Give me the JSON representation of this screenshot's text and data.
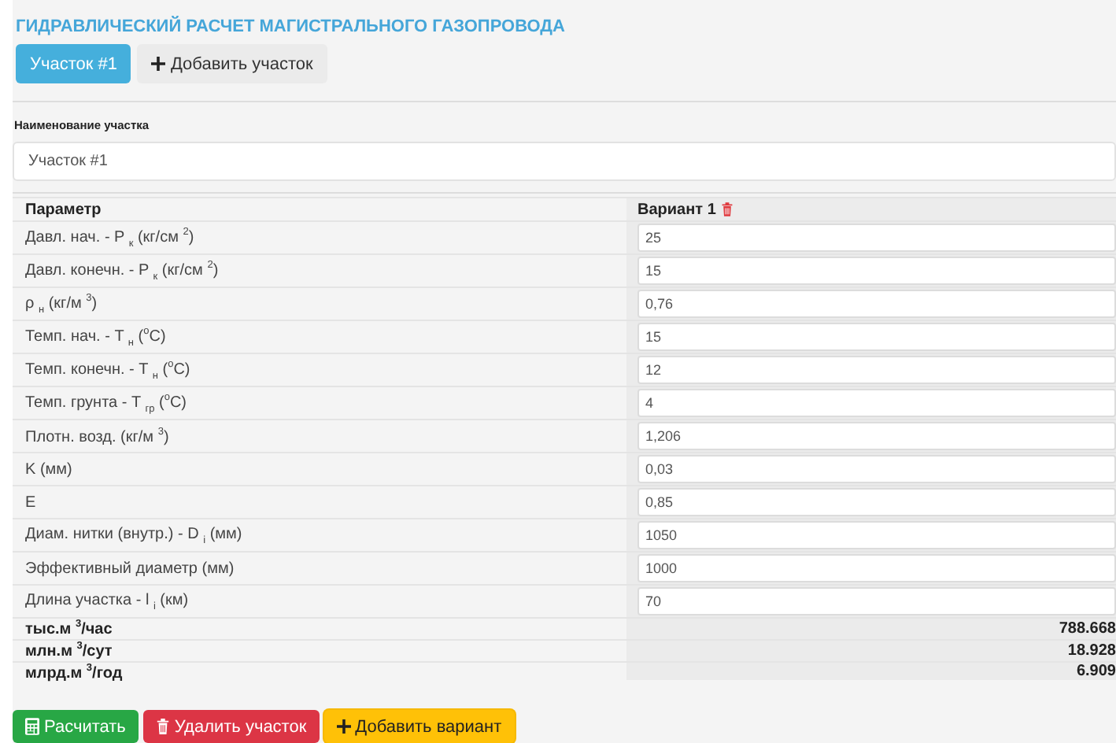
{
  "title": "ГИДРАВЛИЧЕСКИЙ РАСЧЕТ МАГИСТРАЛЬНОГО ГАЗОПРОВОДА",
  "tabs": [
    {
      "label": "Участок #1",
      "selected": true
    }
  ],
  "add_section_button": "Добавить участок",
  "section_name": {
    "label": "Наименование участка",
    "value": "Участок #1"
  },
  "table": {
    "columns": [
      "Параметр",
      "Вариант 1"
    ],
    "rows": [
      {
        "label": "Давл. нач. - P $_{к}$ (кг/см $^{2}$)",
        "value": "25"
      },
      {
        "label": "Давл. конечн. - P $_{к}$ (кг/см $^{2}$)",
        "value": "15"
      },
      {
        "label": "ρ $_{н}$ (кг/м $^{3}$)",
        "value": "0,76"
      },
      {
        "label": "Темп. нач. - T $_{н}$ ($^{o}$C)",
        "value": "15"
      },
      {
        "label": "Темп. конечн. - T $_{н}$ ($^{o}$C)",
        "value": "12"
      },
      {
        "label": "Темп. грунта - T $_{гр}$ ($^{o}$C)",
        "value": "4"
      },
      {
        "label": "Плотн. возд. (кг/м $^{3}$)",
        "value": "1,206"
      },
      {
        "label": "K (мм)",
        "value": "0,03"
      },
      {
        "label": "E",
        "value": "0,85"
      },
      {
        "label": "Диам. нитки (внутр.) - D $_{i}$ (мм)",
        "value": "1050"
      },
      {
        "label": "Эффективный диаметр (мм)",
        "value": "1000"
      },
      {
        "label": "Длина участка - l $_{i}$ (км)",
        "value": "70"
      }
    ],
    "results": [
      {
        "label": "тыс.м $^{3}$/час",
        "value": "788.668"
      },
      {
        "label": "млн.м $^{3}$/сут",
        "value": "18.928"
      },
      {
        "label": "млрд.м $^{3}$/год",
        "value": "6.909"
      }
    ]
  },
  "buttons": [
    {
      "kind": "calculate",
      "label": "Расчитать"
    },
    {
      "kind": "delete",
      "label": "Удалить участок"
    },
    {
      "kind": "add",
      "label": "Добавить вариант"
    }
  ]
}
